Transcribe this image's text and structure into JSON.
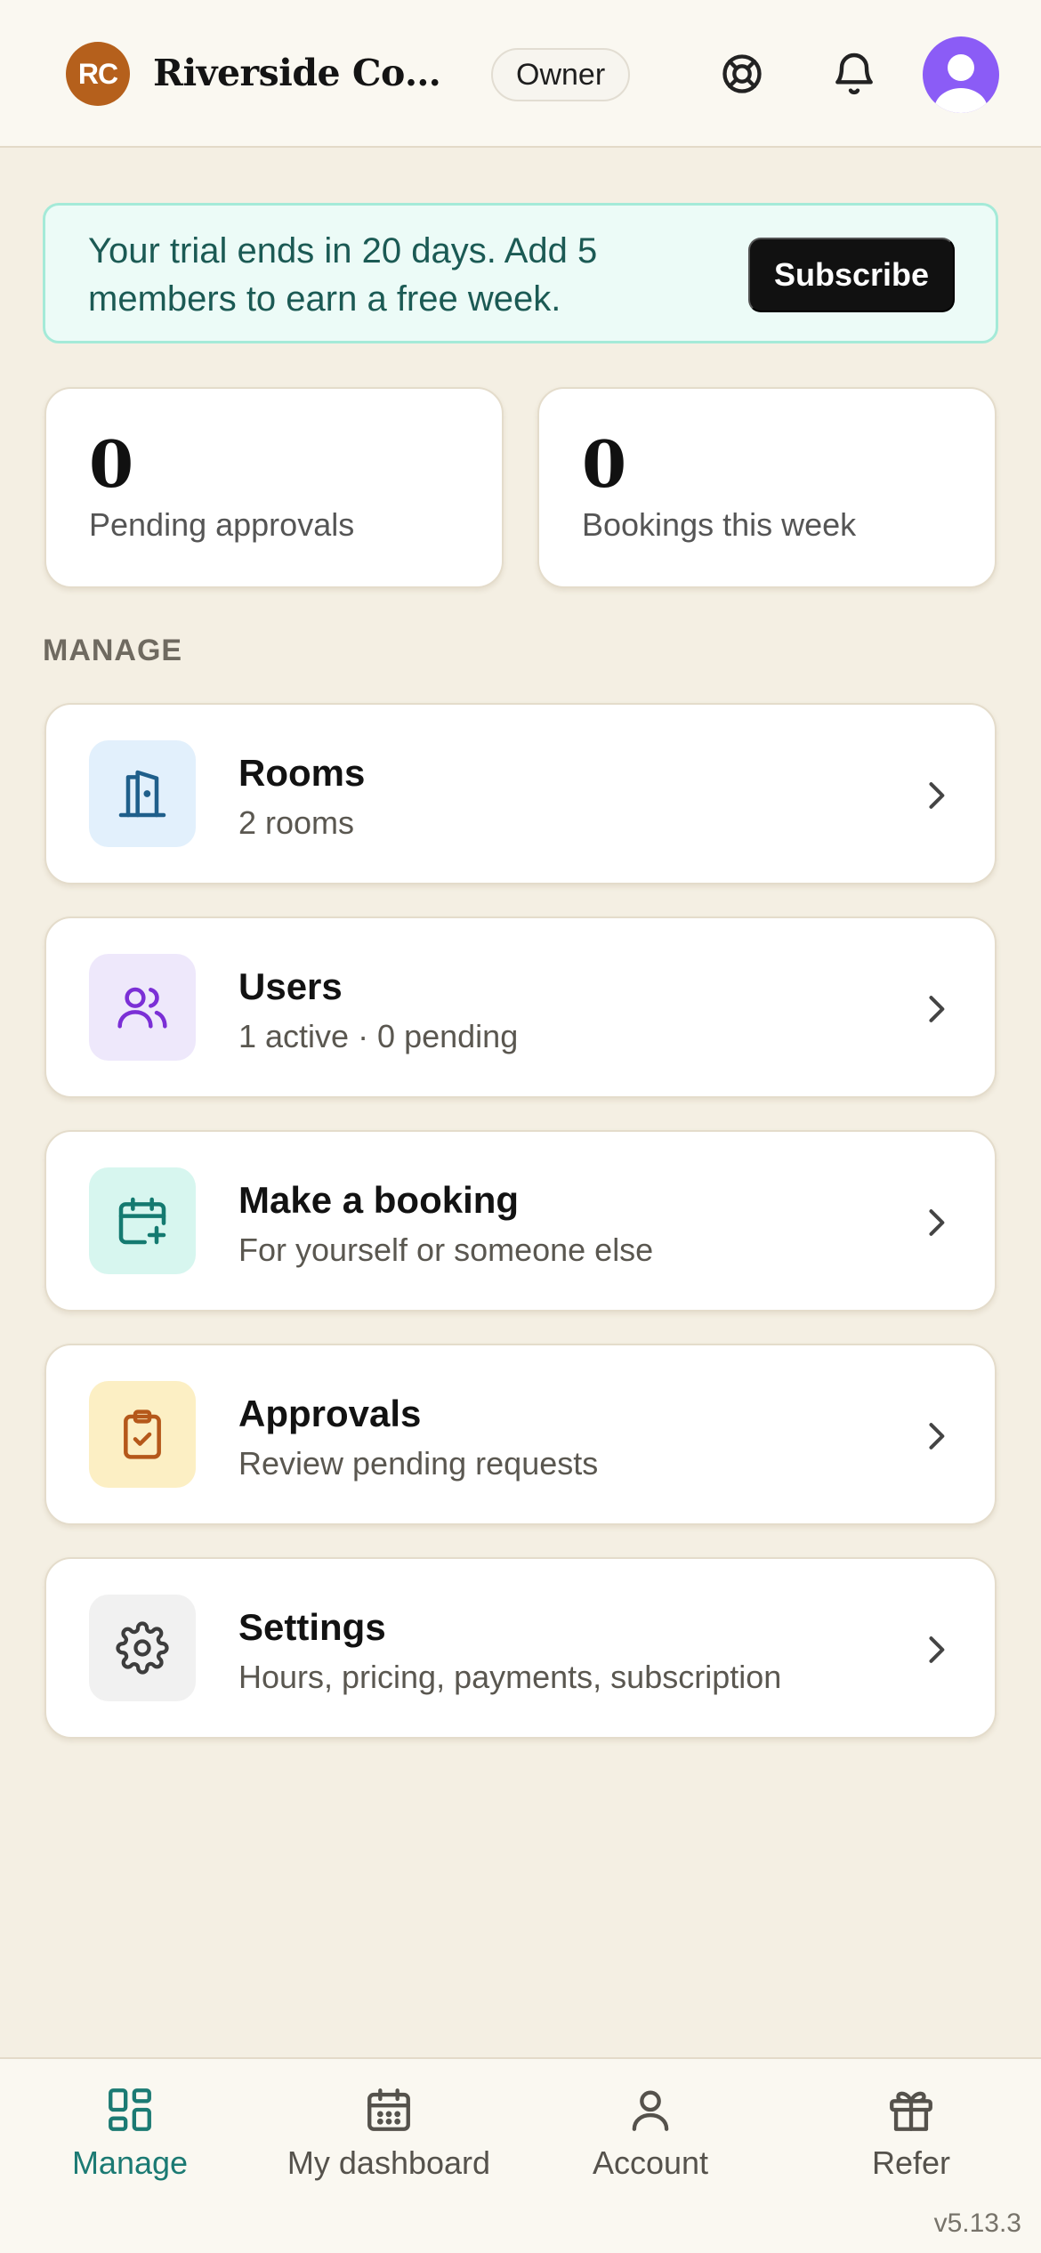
{
  "header": {
    "org_initials": "RC",
    "org_name": "Riverside Coun…",
    "role": "Owner",
    "help_icon": "lifebuoy-icon",
    "notifications_icon": "bell-icon",
    "avatar_icon": "user-avatar"
  },
  "trial_banner": {
    "message": "Your trial ends in 20 days. Add 5 members to earn a free week.",
    "button_label": "Subscribe"
  },
  "stats": [
    {
      "value": "0",
      "label": "Pending approvals"
    },
    {
      "value": "0",
      "label": "Bookings this week"
    }
  ],
  "section_label": "MANAGE",
  "menu": [
    {
      "title": "Rooms",
      "subtitle": "2 rooms",
      "icon": "door-icon",
      "icon_bg": "#e2f0fc",
      "icon_color": "#1f5f8b"
    },
    {
      "title": "Users",
      "subtitle": "1 active · 0 pending",
      "icon": "users-icon",
      "icon_bg": "#eee8fb",
      "icon_color": "#7b2fd6"
    },
    {
      "title": "Make a booking",
      "subtitle": "For yourself or someone else",
      "icon": "calendar-plus-icon",
      "icon_bg": "#d7f6ef",
      "icon_color": "#147a70"
    },
    {
      "title": "Approvals",
      "subtitle": "Review pending requests",
      "icon": "clipboard-check-icon",
      "icon_bg": "#fcefc4",
      "icon_color": "#b5581a"
    },
    {
      "title": "Settings",
      "subtitle": "Hours, pricing, payments, subscription",
      "icon": "gear-icon",
      "icon_bg": "#f1f1f1",
      "icon_color": "#3d3d3d"
    }
  ],
  "nav": [
    {
      "label": "Manage",
      "icon": "grid-icon",
      "active": true
    },
    {
      "label": "My dashboard",
      "icon": "calendar-icon",
      "active": false
    },
    {
      "label": "Account",
      "icon": "person-icon",
      "active": false
    },
    {
      "label": "Refer",
      "icon": "gift-icon",
      "active": false
    }
  ],
  "version": "v5.13.3",
  "colors": {
    "background": "#f4efe3",
    "accent": "#1b7a73",
    "org_avatar": "#b5601c",
    "user_avatar": "#8b5cf6"
  }
}
